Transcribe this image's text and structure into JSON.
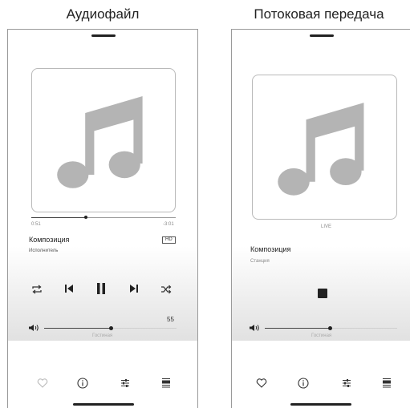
{
  "left": {
    "caption": "Аудиофайл",
    "track_title": "Композиция",
    "artist": "Исполнитель",
    "time_elapsed": "0:51",
    "time_remaining": "-3:01",
    "quality_badge": "HD",
    "progress": 0.27,
    "volume_value": "55",
    "volume_level": 0.55,
    "room": "Гостиная",
    "icons": {
      "repeat": "repeat-icon",
      "previous": "previous-icon",
      "pause": "pause-icon",
      "next": "next-icon",
      "shuffle": "shuffle-icon",
      "volume": "volume-icon",
      "favorite": "heart-icon",
      "info": "info-icon",
      "settings": "sliders-icon",
      "queue": "queue-icon"
    }
  },
  "right": {
    "caption": "Потоковая передача",
    "live_label": "LIVE",
    "track_title": "Композиция",
    "station": "Станция",
    "volume_level": 0.48,
    "room": "Гостиная",
    "icons": {
      "stop": "stop-icon",
      "volume": "volume-icon",
      "favorite": "heart-icon",
      "info": "info-icon",
      "settings": "sliders-icon",
      "queue": "queue-icon"
    }
  },
  "colors": {
    "accent": "#222222",
    "art_note": "#b4b4b4",
    "muted_text": "#888888"
  }
}
